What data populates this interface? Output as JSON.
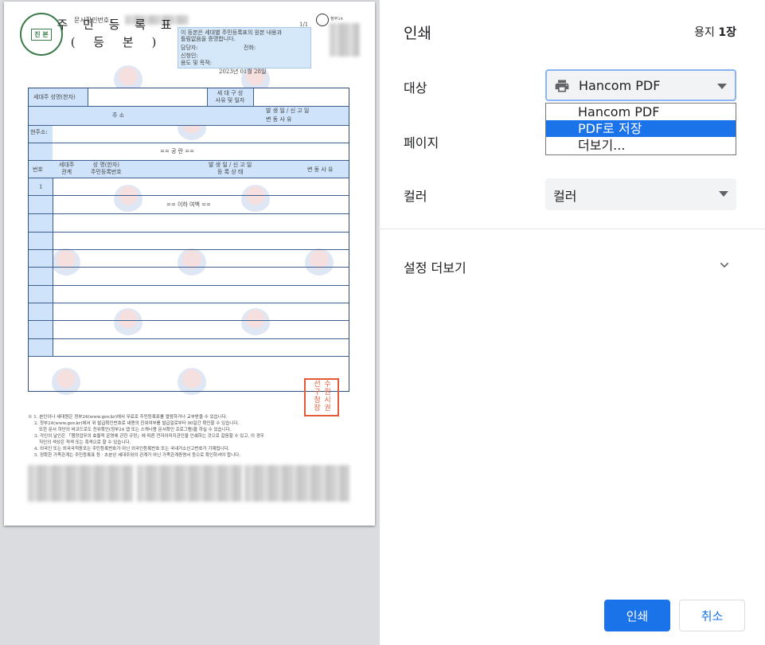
{
  "document": {
    "doc_number_label": "문서확인번호 :",
    "page_indicator": "1/1",
    "qr_label": "정부24",
    "seal_text": "진 본",
    "title": "주 민 등 록 표",
    "subtitle": "( 등      본 )",
    "certification_lines": [
      "이 등본은 세대별 주민등록표의 원본 내용과",
      "틀림없음을 증명합니다."
    ],
    "officer_label": "담당자:",
    "phone_label": "전화:",
    "applicant_label": "신청인:",
    "purpose_label": "용도 및 목적:",
    "issue_date": "2023년 01월 28일",
    "table": {
      "householder_label": "세대주 성명(한자)",
      "composition_label": "세 대 구 성\n사유 및 일자",
      "address_header": "주                    소",
      "occurrence_header_1": "발 생 일 / 신 고 일",
      "occurrence_header_2": "변   동   사   유",
      "current_address_label": "현주소:",
      "blank_marker": "==  공    란  ==",
      "member_headers": {
        "number": "번호",
        "relation": "세대주\n관계",
        "name_rrn": "성 명(한자)\n주민등록번호",
        "occurrence": "발 생 일 / 신 고 일\n등 록 상 태",
        "change_reason": "변 동 사 유"
      },
      "first_row_number": "1",
      "end_marker": "== 이하 여백 =="
    },
    "stamp_text": "수원시권선구청장",
    "notes": [
      "※ 1. 본인이나 세대원은 정부24(www.gov.kr)에서 무료로 주민등록표를 열람하거나 교부받을 수 있습니다.",
      "2. 정부24(www.gov.kr)에서 위 발급확인번호로 내용의 진위여부를 발급일로부터 90일간 확인할 수 있습니다.",
      "또한 문서 하단의 바코드로도 진위확인(정부24 앱 또는 스캐너용 문서확인 프로그램)을 하실 수 있습니다.",
      "3. 각인의 날인은 「행정업무의 효율적 운영에 관한 규정」에 따른 전자이미지관인을 인쇄하는 것으로 갈음할 수 있고, 이 경우",
      "직인의 색상은 적색 또는 흑색으로 할 수 있습니다.",
      "4. 외국인 또는 외국국적동포는 주민등록번호가 아닌 외국인등록번호 또는 국내거소신고번호가 기재됩니다.",
      "5. 정확한 가족관계는 주민등록표 등ㆍ초본상 세대주와의 관계가 아닌 가족관계증명서 등으로 확인하셔야 합니다."
    ]
  },
  "dialog": {
    "title": "인쇄",
    "sheet_count_prefix": "용지 ",
    "sheet_count_value": "1장",
    "destination_label": "대상",
    "destination_value": "Hancom PDF",
    "destination_options": [
      "Hancom PDF",
      "PDF로 저장",
      "더보기..."
    ],
    "highlighted_option_index": 1,
    "pages_label": "페이지",
    "color_label": "컬러",
    "color_value": "컬러",
    "more_settings_label": "설정 더보기",
    "print_button": "인쇄",
    "cancel_button": "취소"
  },
  "colors": {
    "accent": "#1a73e8",
    "table_header_bg": "#cfe4fb",
    "stamp_red": "#e35a3a",
    "seal_green": "#3b7a4a"
  }
}
